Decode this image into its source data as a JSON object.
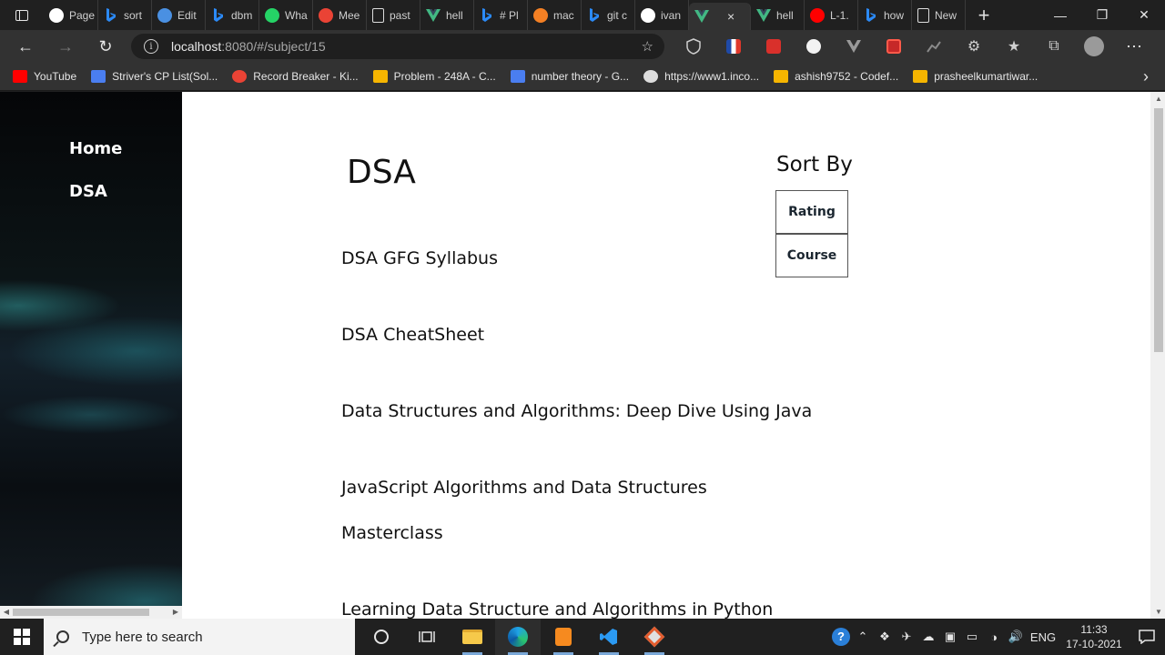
{
  "browser": {
    "tabs": [
      {
        "label": "Page",
        "icon": "github-icon",
        "color": "#ffffff"
      },
      {
        "label": "sort",
        "icon": "bing-icon",
        "color": "#2b8af7"
      },
      {
        "label": "Edit",
        "icon": "cloud-icon",
        "color": "#4a90e2"
      },
      {
        "label": "dbm",
        "icon": "bing-icon",
        "color": "#2b8af7"
      },
      {
        "label": "Wha",
        "icon": "whatsapp-icon",
        "color": "#25d366"
      },
      {
        "label": "Mee",
        "icon": "meet-icon",
        "color": "#ea4335"
      },
      {
        "label": "past",
        "icon": "page-icon",
        "color": "#dddddd"
      },
      {
        "label": "hell",
        "icon": "vue-icon",
        "color": "#42b883"
      },
      {
        "label": "# Pl",
        "icon": "bing-icon",
        "color": "#2b8af7"
      },
      {
        "label": "mac",
        "icon": "stack-icon",
        "color": "#f48024"
      },
      {
        "label": "git c",
        "icon": "bing-icon",
        "color": "#2b8af7"
      },
      {
        "label": "ivan",
        "icon": "github-icon",
        "color": "#ffffff"
      },
      {
        "label": "",
        "icon": "vue-icon",
        "color": "#42b883",
        "active": true
      },
      {
        "label": "hell",
        "icon": "vue-icon",
        "color": "#42b883"
      },
      {
        "label": "L-1.",
        "icon": "youtube-icon",
        "color": "#ff0000"
      },
      {
        "label": "how",
        "icon": "bing-icon",
        "color": "#2b8af7"
      },
      {
        "label": "New",
        "icon": "newtab-icon",
        "color": "#dddddd"
      }
    ],
    "tab_close": "×",
    "new_tab": "+",
    "url_host": "localhost",
    "url_rest": ":8080/#/subject/15",
    "bookmarks": [
      {
        "label": "YouTube",
        "color": "#ff0000"
      },
      {
        "label": "Striver's CP List(Sol...",
        "color": "#4a7ef0"
      },
      {
        "label": "Record Breaker - Ki...",
        "color": "#ea4335"
      },
      {
        "label": "Problem - 248A - C...",
        "color": "#f6b500"
      },
      {
        "label": "number theory - G...",
        "color": "#4a7ef0"
      },
      {
        "label": "https://www1.inco...",
        "color": "#dddddd"
      },
      {
        "label": "ashish9752 - Codef...",
        "color": "#f6b500"
      },
      {
        "label": "prasheelkumartiwar...",
        "color": "#f6b500"
      }
    ]
  },
  "sidebar": {
    "items": [
      {
        "label": "Home"
      },
      {
        "label": "DSA"
      }
    ]
  },
  "main": {
    "subject_title": "DSA",
    "courses": [
      {
        "title": "DSA GFG Syllabus"
      },
      {
        "title": "DSA CheatSheet"
      },
      {
        "title": "Data Structures and Algorithms: Deep Dive Using Java"
      },
      {
        "title": "JavaScript Algorithms and Data Structures"
      },
      {
        "title": "Masterclass"
      },
      {
        "title": "Learning Data Structure and Algorithms in Python"
      }
    ],
    "sort": {
      "title": "Sort By",
      "options": [
        "Rating",
        "Course"
      ]
    }
  },
  "taskbar": {
    "search_placeholder": "Type here to search",
    "language": "ENG",
    "time": "11:33",
    "date": "17-10-2021"
  }
}
